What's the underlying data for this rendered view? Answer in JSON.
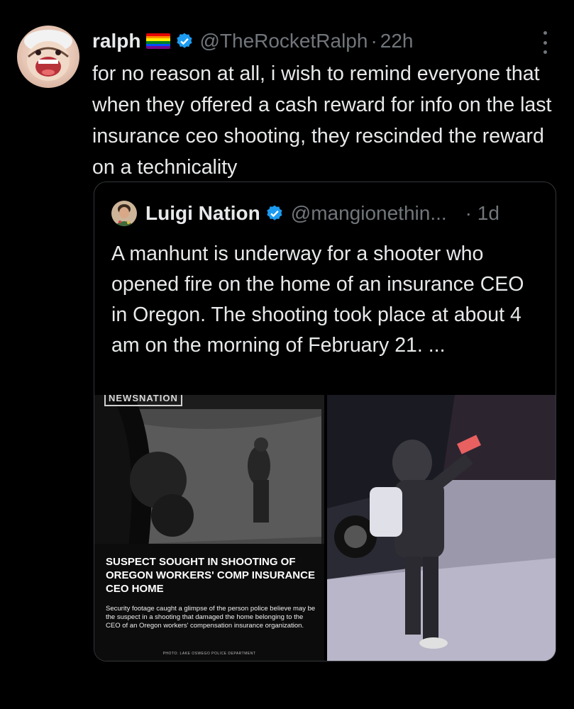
{
  "tweet": {
    "author_name": "ralph",
    "handle": "@TheRocketRalph",
    "separator": "·",
    "time": "22h",
    "text": "for no reason at all, i wish to remind everyone that when they offered a cash reward for info on the last insurance ceo shooting, they rescinded the reward on a technicality",
    "avatar_icon": "cartoon-character-avatar",
    "flag_icon": "pride-flag-emoji",
    "verified_icon": "verified-badge-icon",
    "more_icon": "more-options-icon"
  },
  "quote": {
    "author_name": "Luigi Nation",
    "handle": "@mangionethin...",
    "time": "· 1d",
    "text": "A manhunt is underway for a shooter who opened fire on the home of an insurance CEO in Oregon. The shooting took place at about 4 am on the morning of February 21. ...",
    "avatar_icon": "profile-photo-avatar",
    "verified_icon": "verified-badge-icon"
  },
  "media": {
    "left": {
      "logo": "NEWSNATION",
      "headline": "SUSPECT SOUGHT IN SHOOTING OF OREGON WORKERS' COMP INSURANCE CEO HOME",
      "caption": "Security footage caught a glimpse of the person police believe may be the suspect in a shooting that damaged the home belonging to the CEO of an Oregon workers' compensation insurance organization.",
      "credit": "PHOTO: LAKE OSWEGO POLICE DEPARTMENT"
    },
    "right": {
      "description_icon": "security-camera-still-image"
    }
  },
  "colors": {
    "background": "#000000",
    "text_primary": "#e7e9ea",
    "text_secondary": "#71767b",
    "verified_blue": "#1d9bf0",
    "border": "#333639"
  }
}
